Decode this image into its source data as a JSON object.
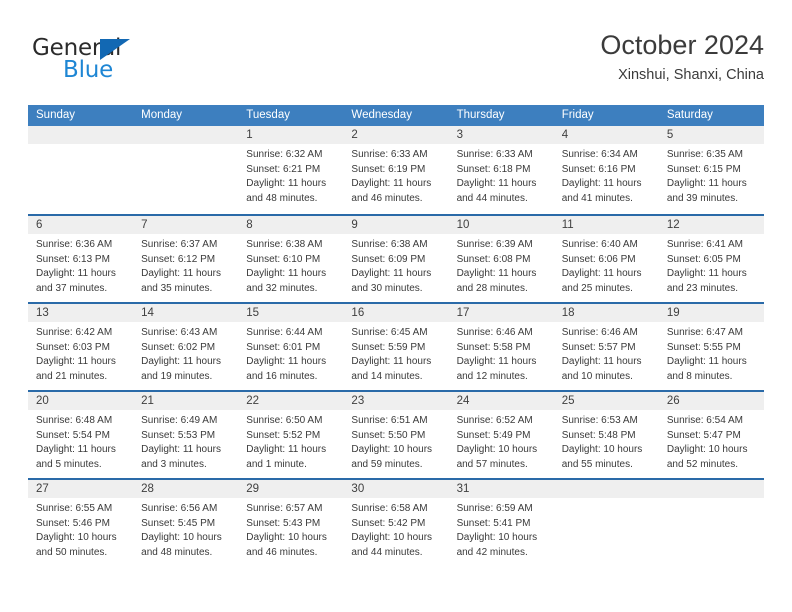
{
  "brand": {
    "name_part1": "General",
    "name_part2": "Blue",
    "triangle_color": "#1268b3",
    "blue_color": "#1e86d4"
  },
  "header": {
    "title": "October 2024",
    "subtitle": "Xinshui, Shanxi, China"
  },
  "theme": {
    "header_bar": "#3d7fbf",
    "week_divider": "#2a6aa8",
    "day_number_band": "#efefef",
    "text": "#3a3a3a"
  },
  "calendar": {
    "weekday_headers": [
      "Sunday",
      "Monday",
      "Tuesday",
      "Wednesday",
      "Thursday",
      "Friday",
      "Saturday"
    ],
    "weeks": [
      [
        {
          "day": "",
          "empty": true
        },
        {
          "day": "",
          "empty": true
        },
        {
          "day": "1",
          "sunrise": "Sunrise: 6:32 AM",
          "sunset": "Sunset: 6:21 PM",
          "daylight1": "Daylight: 11 hours",
          "daylight2": "and 48 minutes."
        },
        {
          "day": "2",
          "sunrise": "Sunrise: 6:33 AM",
          "sunset": "Sunset: 6:19 PM",
          "daylight1": "Daylight: 11 hours",
          "daylight2": "and 46 minutes."
        },
        {
          "day": "3",
          "sunrise": "Sunrise: 6:33 AM",
          "sunset": "Sunset: 6:18 PM",
          "daylight1": "Daylight: 11 hours",
          "daylight2": "and 44 minutes."
        },
        {
          "day": "4",
          "sunrise": "Sunrise: 6:34 AM",
          "sunset": "Sunset: 6:16 PM",
          "daylight1": "Daylight: 11 hours",
          "daylight2": "and 41 minutes."
        },
        {
          "day": "5",
          "sunrise": "Sunrise: 6:35 AM",
          "sunset": "Sunset: 6:15 PM",
          "daylight1": "Daylight: 11 hours",
          "daylight2": "and 39 minutes."
        }
      ],
      [
        {
          "day": "6",
          "sunrise": "Sunrise: 6:36 AM",
          "sunset": "Sunset: 6:13 PM",
          "daylight1": "Daylight: 11 hours",
          "daylight2": "and 37 minutes."
        },
        {
          "day": "7",
          "sunrise": "Sunrise: 6:37 AM",
          "sunset": "Sunset: 6:12 PM",
          "daylight1": "Daylight: 11 hours",
          "daylight2": "and 35 minutes."
        },
        {
          "day": "8",
          "sunrise": "Sunrise: 6:38 AM",
          "sunset": "Sunset: 6:10 PM",
          "daylight1": "Daylight: 11 hours",
          "daylight2": "and 32 minutes."
        },
        {
          "day": "9",
          "sunrise": "Sunrise: 6:38 AM",
          "sunset": "Sunset: 6:09 PM",
          "daylight1": "Daylight: 11 hours",
          "daylight2": "and 30 minutes."
        },
        {
          "day": "10",
          "sunrise": "Sunrise: 6:39 AM",
          "sunset": "Sunset: 6:08 PM",
          "daylight1": "Daylight: 11 hours",
          "daylight2": "and 28 minutes."
        },
        {
          "day": "11",
          "sunrise": "Sunrise: 6:40 AM",
          "sunset": "Sunset: 6:06 PM",
          "daylight1": "Daylight: 11 hours",
          "daylight2": "and 25 minutes."
        },
        {
          "day": "12",
          "sunrise": "Sunrise: 6:41 AM",
          "sunset": "Sunset: 6:05 PM",
          "daylight1": "Daylight: 11 hours",
          "daylight2": "and 23 minutes."
        }
      ],
      [
        {
          "day": "13",
          "sunrise": "Sunrise: 6:42 AM",
          "sunset": "Sunset: 6:03 PM",
          "daylight1": "Daylight: 11 hours",
          "daylight2": "and 21 minutes."
        },
        {
          "day": "14",
          "sunrise": "Sunrise: 6:43 AM",
          "sunset": "Sunset: 6:02 PM",
          "daylight1": "Daylight: 11 hours",
          "daylight2": "and 19 minutes."
        },
        {
          "day": "15",
          "sunrise": "Sunrise: 6:44 AM",
          "sunset": "Sunset: 6:01 PM",
          "daylight1": "Daylight: 11 hours",
          "daylight2": "and 16 minutes."
        },
        {
          "day": "16",
          "sunrise": "Sunrise: 6:45 AM",
          "sunset": "Sunset: 5:59 PM",
          "daylight1": "Daylight: 11 hours",
          "daylight2": "and 14 minutes."
        },
        {
          "day": "17",
          "sunrise": "Sunrise: 6:46 AM",
          "sunset": "Sunset: 5:58 PM",
          "daylight1": "Daylight: 11 hours",
          "daylight2": "and 12 minutes."
        },
        {
          "day": "18",
          "sunrise": "Sunrise: 6:46 AM",
          "sunset": "Sunset: 5:57 PM",
          "daylight1": "Daylight: 11 hours",
          "daylight2": "and 10 minutes."
        },
        {
          "day": "19",
          "sunrise": "Sunrise: 6:47 AM",
          "sunset": "Sunset: 5:55 PM",
          "daylight1": "Daylight: 11 hours",
          "daylight2": "and 8 minutes."
        }
      ],
      [
        {
          "day": "20",
          "sunrise": "Sunrise: 6:48 AM",
          "sunset": "Sunset: 5:54 PM",
          "daylight1": "Daylight: 11 hours",
          "daylight2": "and 5 minutes."
        },
        {
          "day": "21",
          "sunrise": "Sunrise: 6:49 AM",
          "sunset": "Sunset: 5:53 PM",
          "daylight1": "Daylight: 11 hours",
          "daylight2": "and 3 minutes."
        },
        {
          "day": "22",
          "sunrise": "Sunrise: 6:50 AM",
          "sunset": "Sunset: 5:52 PM",
          "daylight1": "Daylight: 11 hours",
          "daylight2": "and 1 minute."
        },
        {
          "day": "23",
          "sunrise": "Sunrise: 6:51 AM",
          "sunset": "Sunset: 5:50 PM",
          "daylight1": "Daylight: 10 hours",
          "daylight2": "and 59 minutes."
        },
        {
          "day": "24",
          "sunrise": "Sunrise: 6:52 AM",
          "sunset": "Sunset: 5:49 PM",
          "daylight1": "Daylight: 10 hours",
          "daylight2": "and 57 minutes."
        },
        {
          "day": "25",
          "sunrise": "Sunrise: 6:53 AM",
          "sunset": "Sunset: 5:48 PM",
          "daylight1": "Daylight: 10 hours",
          "daylight2": "and 55 minutes."
        },
        {
          "day": "26",
          "sunrise": "Sunrise: 6:54 AM",
          "sunset": "Sunset: 5:47 PM",
          "daylight1": "Daylight: 10 hours",
          "daylight2": "and 52 minutes."
        }
      ],
      [
        {
          "day": "27",
          "sunrise": "Sunrise: 6:55 AM",
          "sunset": "Sunset: 5:46 PM",
          "daylight1": "Daylight: 10 hours",
          "daylight2": "and 50 minutes."
        },
        {
          "day": "28",
          "sunrise": "Sunrise: 6:56 AM",
          "sunset": "Sunset: 5:45 PM",
          "daylight1": "Daylight: 10 hours",
          "daylight2": "and 48 minutes."
        },
        {
          "day": "29",
          "sunrise": "Sunrise: 6:57 AM",
          "sunset": "Sunset: 5:43 PM",
          "daylight1": "Daylight: 10 hours",
          "daylight2": "and 46 minutes."
        },
        {
          "day": "30",
          "sunrise": "Sunrise: 6:58 AM",
          "sunset": "Sunset: 5:42 PM",
          "daylight1": "Daylight: 10 hours",
          "daylight2": "and 44 minutes."
        },
        {
          "day": "31",
          "sunrise": "Sunrise: 6:59 AM",
          "sunset": "Sunset: 5:41 PM",
          "daylight1": "Daylight: 10 hours",
          "daylight2": "and 42 minutes."
        },
        {
          "day": "",
          "empty": true
        },
        {
          "day": "",
          "empty": true
        }
      ]
    ]
  }
}
